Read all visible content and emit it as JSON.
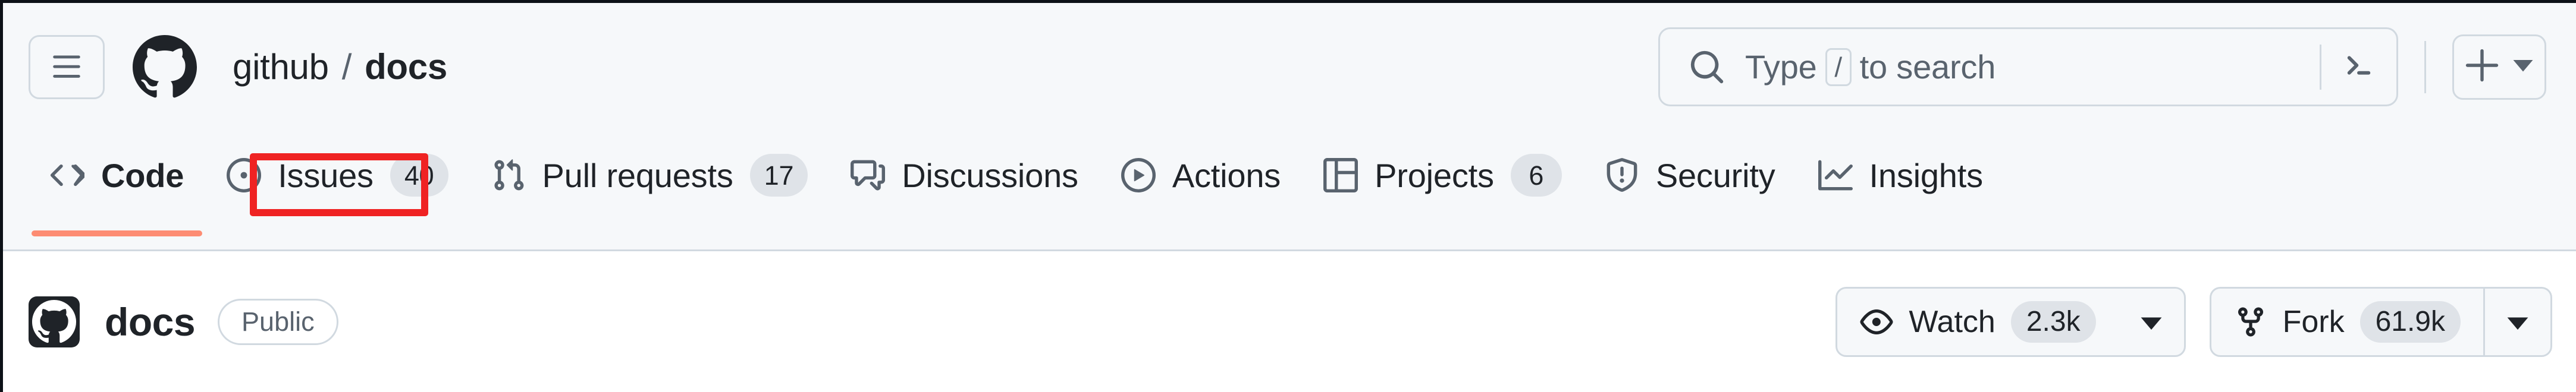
{
  "global_header": {
    "hamburger_icon": "three-bars-icon",
    "logo_icon": "github-octocat-logo",
    "breadcrumb": {
      "owner": "github",
      "separator": "/",
      "repo": "docs"
    },
    "search": {
      "icon": "search-icon",
      "placeholder_prefix": "Type",
      "placeholder_key": "/",
      "placeholder_suffix": "to search",
      "terminal_icon": "command-palette-terminal-icon"
    },
    "create_new": {
      "plus_icon": "plus-icon",
      "caret_icon": "chevron-down-icon"
    }
  },
  "repo_nav": {
    "active_tab": "Code",
    "tabs": [
      {
        "label": "Code",
        "icon": "code-icon",
        "count": "",
        "active": true
      },
      {
        "label": "Issues",
        "icon": "issue-opened-icon",
        "count": "40",
        "active": false
      },
      {
        "label": "Pull requests",
        "icon": "git-pull-request-icon",
        "count": "17",
        "active": false
      },
      {
        "label": "Discussions",
        "icon": "comment-discussion-icon",
        "count": "",
        "active": false
      },
      {
        "label": "Actions",
        "icon": "play-circle-icon",
        "count": "",
        "active": false
      },
      {
        "label": "Projects",
        "icon": "table-project-icon",
        "count": "6",
        "active": false
      },
      {
        "label": "Security",
        "icon": "shield-alert-icon",
        "count": "",
        "active": false
      },
      {
        "label": "Insights",
        "icon": "graph-line-icon",
        "count": "",
        "active": false
      }
    ]
  },
  "annotation": {
    "target": "Issues",
    "color": "#EF2323"
  },
  "repo_header": {
    "avatar_icon": "github-octocat-avatar",
    "name": "docs",
    "visibility": "Public",
    "watch": {
      "label": "Watch",
      "count": "2.3k",
      "icon": "eye-icon",
      "caret_icon": "chevron-down-icon"
    },
    "fork": {
      "label": "Fork",
      "count": "61.9k",
      "icon": "repo-forked-icon",
      "caret_icon": "chevron-down-icon"
    }
  },
  "colors": {
    "header_bg": "#F6F8FA",
    "page_bg": "#FFFFFF",
    "border": "#D1D9E0",
    "text": "#1F2328",
    "muted_text": "#59636E",
    "badge_bg": "#DFE3E8",
    "active_underline": "#FD8C73",
    "annotation_red": "#EF2323"
  }
}
